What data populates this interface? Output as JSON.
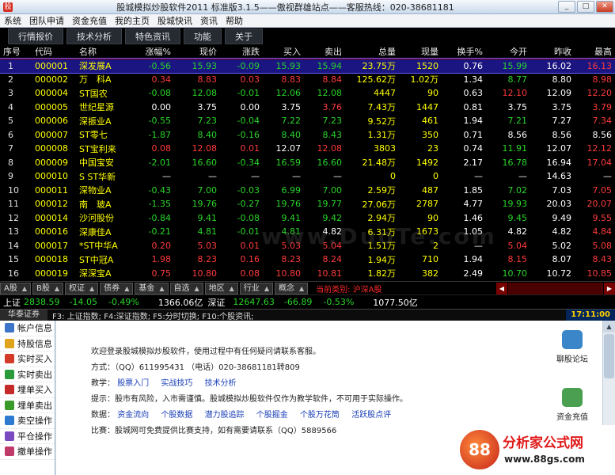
{
  "title": "股城模拟炒股软件2011 标准版3.1.5——傲视群雄站点——客服热线：020-38681181",
  "window_buttons": [
    "_",
    "□",
    "✕"
  ],
  "menu": [
    "系统",
    "团队申请",
    "资金充值",
    "我的主页",
    "股城快讯",
    "资讯",
    "帮助"
  ],
  "tabs": [
    "行情报价",
    "技术分析",
    "特色资讯",
    "功能",
    "关于"
  ],
  "columns": [
    "序号",
    "代码",
    "名称",
    "涨幅%",
    "现价",
    "涨跌",
    "买入",
    "卖出",
    "总量",
    "现量",
    "换手%",
    "今开",
    "昨收",
    "最高"
  ],
  "rows": [
    {
      "seq": "1",
      "code": "000001",
      "name": "深发展A",
      "chg_pct": "-0.56",
      "price": "15.93",
      "chg": "-0.09",
      "bid": "15.93",
      "ask": "15.94",
      "vol": "23.75万",
      "cur": "1520",
      "turn": "0.76",
      "open": "15.99",
      "prev": "16.02",
      "high": "16.13",
      "sel": true,
      "cl": {
        "chg_pct": "dn",
        "price": "dn",
        "chg": "dn",
        "bid": "dn",
        "ask": "dn",
        "vol": "yl",
        "cur": "yl",
        "turn": "wh",
        "open": "dn",
        "prev": "wh",
        "high": "up"
      }
    },
    {
      "seq": "2",
      "code": "000002",
      "name": "万　科A",
      "chg_pct": "0.34",
      "price": "8.83",
      "chg": "0.03",
      "bid": "8.83",
      "ask": "8.84",
      "vol": "125.62万",
      "cur": "1.02万",
      "turn": "1.34",
      "open": "8.77",
      "prev": "8.80",
      "high": "8.98",
      "cl": {
        "chg_pct": "up",
        "price": "up",
        "chg": "up",
        "bid": "up",
        "ask": "up",
        "vol": "yl",
        "cur": "yl",
        "turn": "wh",
        "open": "dn",
        "prev": "wh",
        "high": "up"
      }
    },
    {
      "seq": "3",
      "code": "000004",
      "name": "ST国农",
      "chg_pct": "-0.08",
      "price": "12.08",
      "chg": "-0.01",
      "bid": "12.06",
      "ask": "12.08",
      "vol": "4447",
      "cur": "90",
      "turn": "0.63",
      "open": "12.10",
      "prev": "12.09",
      "high": "12.20",
      "cl": {
        "chg_pct": "dn",
        "price": "dn",
        "chg": "dn",
        "bid": "dn",
        "ask": "dn",
        "vol": "yl",
        "cur": "yl",
        "turn": "wh",
        "open": "up",
        "prev": "wh",
        "high": "up"
      }
    },
    {
      "seq": "4",
      "code": "000005",
      "name": "世纪星源",
      "chg_pct": "0.00",
      "price": "3.75",
      "chg": "0.00",
      "bid": "3.75",
      "ask": "3.76",
      "vol": "7.43万",
      "cur": "1447",
      "turn": "0.81",
      "open": "3.75",
      "prev": "3.75",
      "high": "3.79",
      "cl": {
        "chg_pct": "wh",
        "price": "wh",
        "chg": "wh",
        "bid": "wh",
        "ask": "up",
        "vol": "yl",
        "cur": "yl",
        "turn": "wh",
        "open": "wh",
        "prev": "wh",
        "high": "up"
      }
    },
    {
      "seq": "5",
      "code": "000006",
      "name": "深振业A",
      "chg_pct": "-0.55",
      "price": "7.23",
      "chg": "-0.04",
      "bid": "7.22",
      "ask": "7.23",
      "vol": "9.52万",
      "cur": "461",
      "turn": "1.94",
      "open": "7.21",
      "prev": "7.27",
      "high": "7.34",
      "cl": {
        "chg_pct": "dn",
        "price": "dn",
        "chg": "dn",
        "bid": "dn",
        "ask": "dn",
        "vol": "yl",
        "cur": "yl",
        "turn": "wh",
        "open": "dn",
        "prev": "wh",
        "high": "up"
      }
    },
    {
      "seq": "6",
      "code": "000007",
      "name": "ST零七",
      "chg_pct": "-1.87",
      "price": "8.40",
      "chg": "-0.16",
      "bid": "8.40",
      "ask": "8.43",
      "vol": "1.31万",
      "cur": "350",
      "turn": "0.71",
      "open": "8.56",
      "prev": "8.56",
      "high": "8.56",
      "cl": {
        "chg_pct": "dn",
        "price": "dn",
        "chg": "dn",
        "bid": "dn",
        "ask": "dn",
        "vol": "yl",
        "cur": "yl",
        "turn": "wh",
        "open": "wh",
        "prev": "wh",
        "high": "wh"
      }
    },
    {
      "seq": "7",
      "code": "000008",
      "name": "ST宝利来",
      "chg_pct": "0.08",
      "price": "12.08",
      "chg": "0.01",
      "bid": "12.07",
      "ask": "12.08",
      "vol": "3803",
      "cur": "23",
      "turn": "0.74",
      "open": "11.91",
      "prev": "12.07",
      "high": "12.12",
      "cl": {
        "chg_pct": "up",
        "price": "up",
        "chg": "up",
        "bid": "wh",
        "ask": "up",
        "vol": "yl",
        "cur": "yl",
        "turn": "wh",
        "open": "dn",
        "prev": "wh",
        "high": "up"
      }
    },
    {
      "seq": "8",
      "code": "000009",
      "name": "中国宝安",
      "chg_pct": "-2.01",
      "price": "16.60",
      "chg": "-0.34",
      "bid": "16.59",
      "ask": "16.60",
      "vol": "21.48万",
      "cur": "1492",
      "turn": "2.17",
      "open": "16.78",
      "prev": "16.94",
      "high": "17.04",
      "cl": {
        "chg_pct": "dn",
        "price": "dn",
        "chg": "dn",
        "bid": "dn",
        "ask": "dn",
        "vol": "yl",
        "cur": "yl",
        "turn": "wh",
        "open": "dn",
        "prev": "wh",
        "high": "up"
      }
    },
    {
      "seq": "9",
      "code": "000010",
      "name": "S ST华新",
      "chg_pct": "—",
      "price": "—",
      "chg": "—",
      "bid": "—",
      "ask": "—",
      "vol": "0",
      "cur": "0",
      "turn": "—",
      "open": "—",
      "prev": "14.63",
      "high": "—",
      "cl": {
        "chg_pct": "wh",
        "price": "wh",
        "chg": "wh",
        "bid": "wh",
        "ask": "wh",
        "vol": "yl",
        "cur": "yl",
        "turn": "wh",
        "open": "wh",
        "prev": "wh",
        "high": "wh"
      }
    },
    {
      "seq": "10",
      "code": "000011",
      "name": "深物业A",
      "chg_pct": "-0.43",
      "price": "7.00",
      "chg": "-0.03",
      "bid": "6.99",
      "ask": "7.00",
      "vol": "2.59万",
      "cur": "487",
      "turn": "1.85",
      "open": "7.02",
      "prev": "7.03",
      "high": "7.05",
      "cl": {
        "chg_pct": "dn",
        "price": "dn",
        "chg": "dn",
        "bid": "dn",
        "ask": "dn",
        "vol": "yl",
        "cur": "yl",
        "turn": "wh",
        "open": "dn",
        "prev": "wh",
        "high": "up"
      }
    },
    {
      "seq": "11",
      "code": "000012",
      "name": "南　玻A",
      "chg_pct": "-1.35",
      "price": "19.76",
      "chg": "-0.27",
      "bid": "19.76",
      "ask": "19.77",
      "vol": "27.06万",
      "cur": "2787",
      "turn": "4.77",
      "open": "19.93",
      "prev": "20.03",
      "high": "20.07",
      "cl": {
        "chg_pct": "dn",
        "price": "dn",
        "chg": "dn",
        "bid": "dn",
        "ask": "dn",
        "vol": "yl",
        "cur": "yl",
        "turn": "wh",
        "open": "dn",
        "prev": "wh",
        "high": "up"
      }
    },
    {
      "seq": "12",
      "code": "000014",
      "name": "沙河股份",
      "chg_pct": "-0.84",
      "price": "9.41",
      "chg": "-0.08",
      "bid": "9.41",
      "ask": "9.42",
      "vol": "2.94万",
      "cur": "90",
      "turn": "1.46",
      "open": "9.45",
      "prev": "9.49",
      "high": "9.55",
      "cl": {
        "chg_pct": "dn",
        "price": "dn",
        "chg": "dn",
        "bid": "dn",
        "ask": "dn",
        "vol": "yl",
        "cur": "yl",
        "turn": "wh",
        "open": "dn",
        "prev": "wh",
        "high": "up"
      }
    },
    {
      "seq": "13",
      "code": "000016",
      "name": "深康佳A",
      "chg_pct": "-0.21",
      "price": "4.81",
      "chg": "-0.01",
      "bid": "4.81",
      "ask": "4.82",
      "vol": "6.31万",
      "cur": "1673",
      "turn": "1.05",
      "open": "4.82",
      "prev": "4.82",
      "high": "4.84",
      "cl": {
        "chg_pct": "dn",
        "price": "dn",
        "chg": "dn",
        "bid": "dn",
        "ask": "wh",
        "vol": "yl",
        "cur": "yl",
        "turn": "wh",
        "open": "wh",
        "prev": "wh",
        "high": "up"
      }
    },
    {
      "seq": "14",
      "code": "000017",
      "name": "*ST中华A",
      "chg_pct": "0.20",
      "price": "5.03",
      "chg": "0.01",
      "bid": "5.03",
      "ask": "5.04",
      "vol": "1.51万",
      "cur": "2",
      "turn": "—",
      "open": "5.04",
      "prev": "5.02",
      "high": "5.08",
      "cl": {
        "chg_pct": "up",
        "price": "up",
        "chg": "up",
        "bid": "up",
        "ask": "up",
        "vol": "yl",
        "cur": "yl",
        "turn": "wh",
        "open": "up",
        "prev": "wh",
        "high": "up"
      }
    },
    {
      "seq": "15",
      "code": "000018",
      "name": "ST中冠A",
      "chg_pct": "1.98",
      "price": "8.23",
      "chg": "0.16",
      "bid": "8.23",
      "ask": "8.24",
      "vol": "1.94万",
      "cur": "710",
      "turn": "1.94",
      "open": "8.15",
      "prev": "8.07",
      "high": "8.43",
      "cl": {
        "chg_pct": "up",
        "price": "up",
        "chg": "up",
        "bid": "up",
        "ask": "up",
        "vol": "yl",
        "cur": "yl",
        "turn": "wh",
        "open": "up",
        "prev": "wh",
        "high": "up"
      }
    },
    {
      "seq": "16",
      "code": "000019",
      "name": "深深宝A",
      "chg_pct": "0.75",
      "price": "10.80",
      "chg": "0.08",
      "bid": "10.80",
      "ask": "10.81",
      "vol": "1.82万",
      "cur": "382",
      "turn": "2.49",
      "open": "10.70",
      "prev": "10.72",
      "high": "10.85",
      "cl": {
        "chg_pct": "up",
        "price": "up",
        "chg": "up",
        "bid": "up",
        "ask": "up",
        "vol": "yl",
        "cur": "yl",
        "turn": "wh",
        "open": "dn",
        "prev": "wh",
        "high": "up"
      }
    }
  ],
  "category_tabs": [
    "A股",
    "B股",
    "权证",
    "债券",
    "基金",
    "自选",
    "地区",
    "行业",
    "概念"
  ],
  "current_category": "当前类别: 沪深A股",
  "index_bar": {
    "sh_label": "上证",
    "sh_value": "2838.59",
    "sh_chg": "-14.05",
    "sh_pct": "-0.49%",
    "sh_amount": "1366.06亿",
    "sz_label": "深证",
    "sz_value": "12647.63",
    "sz_chg": "-66.89",
    "sz_pct": "-0.53%",
    "sz_amount": "1077.50亿"
  },
  "status": {
    "broker": "华泰证券",
    "hint": "F3: 上证指数; F4:深证指数; F5:分时切换; F10:个股资讯;",
    "clock": "17:11:00"
  },
  "left_nav": [
    {
      "label": "帐户信息",
      "color": "#3b74c9"
    },
    {
      "label": "持股信息",
      "color": "#e0a41c"
    },
    {
      "label": "实时买入",
      "color": "#d43a2a"
    },
    {
      "label": "实时卖出",
      "color": "#2a9a3a"
    },
    {
      "label": "埋单买入",
      "color": "#c42a2a"
    },
    {
      "label": "埋单卖出",
      "color": "#3a9a2a"
    },
    {
      "label": "卖空操作",
      "color": "#2d7ad0"
    },
    {
      "label": "平仓操作",
      "color": "#7a4ac0"
    },
    {
      "label": "撤单操作",
      "color": "#c03a6a"
    }
  ],
  "content": {
    "welcome": "欢迎登录股城模拟炒股软件，使用过程中有任何疑问请联系客服。",
    "contact": "方式：（QQ）611995431  （电话）020-38681181转809",
    "teach_label": "教学：",
    "teach_links": [
      "股票入门",
      "实战技巧",
      "技术分析"
    ],
    "tip": "提示：股市有风险，入市需谨慎。股城模拟炒股软件仅作为教学软件，不可用于实际操作。",
    "data_label": "数据：",
    "data_links": [
      "资金流向",
      "个股数据",
      "潜力股追踪",
      "个股掘金",
      "个股万花筒",
      "活跃股点评"
    ],
    "contest": "比赛：股城网可免费提供比赛支持，如有需要请联系（QQ）5889566"
  },
  "side_buttons": [
    {
      "label": "聊股论坛",
      "color": "#3a86c8"
    },
    {
      "label": "资金充值",
      "color": "#4aa050"
    }
  ],
  "watermark": {
    "brand": "分析家公式网",
    "url": "www.88gs.com",
    "logo_text": "88"
  },
  "grid_watermark": "www.DuoTe.com"
}
